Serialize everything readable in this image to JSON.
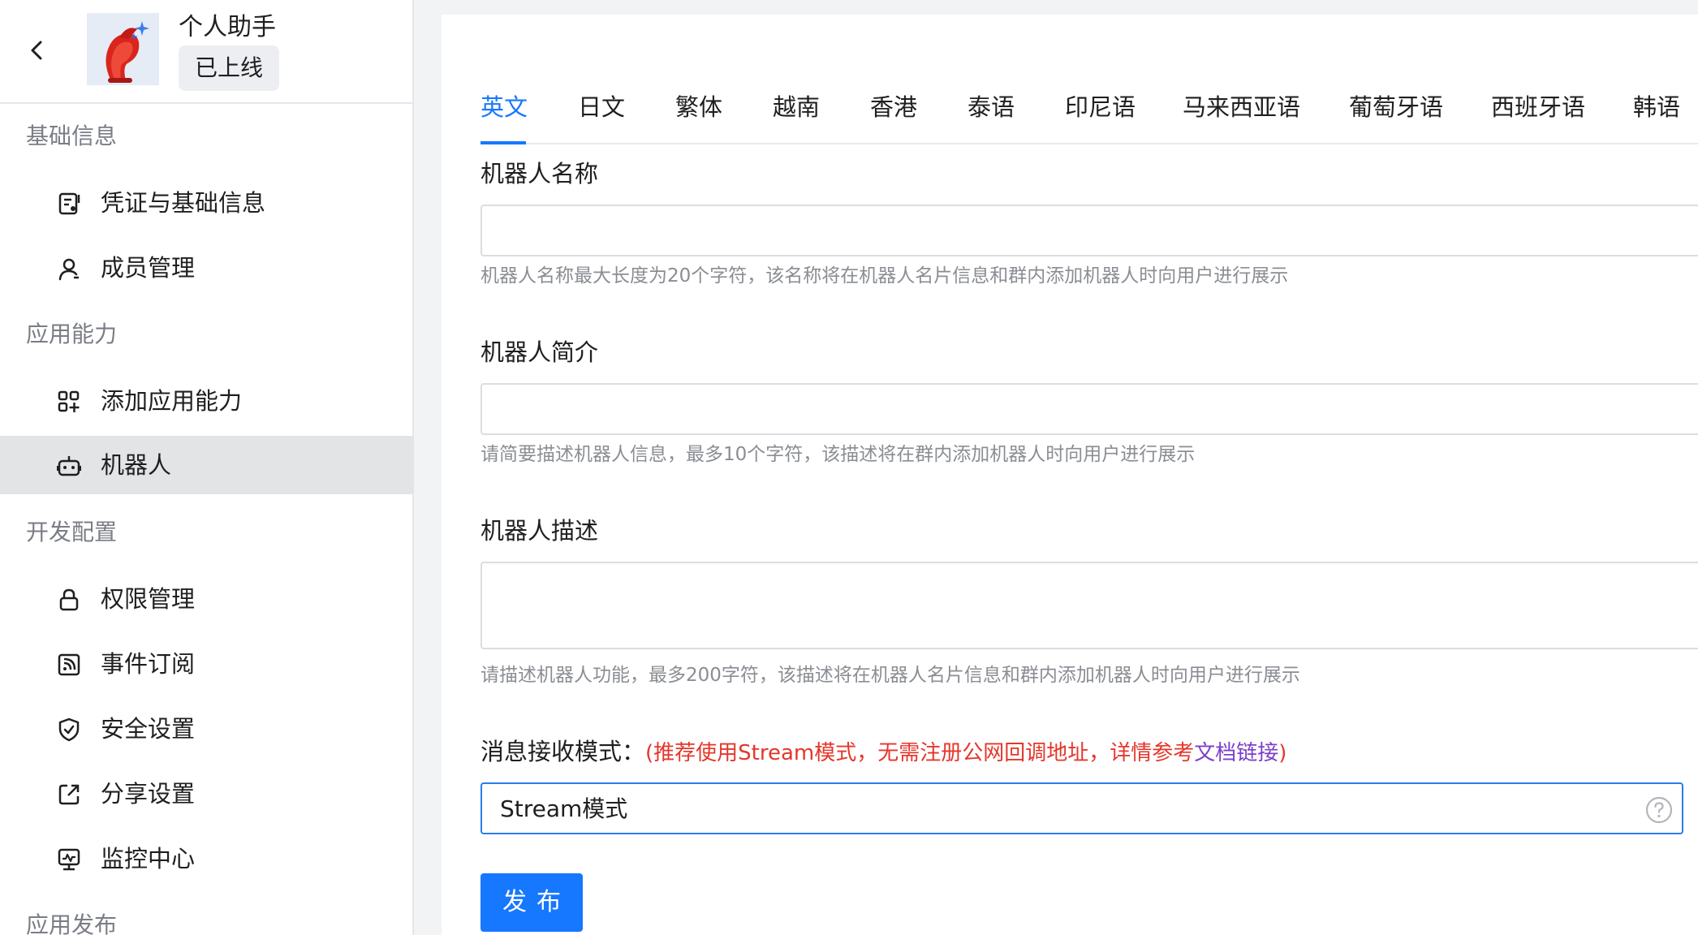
{
  "app": {
    "name": "个人助手",
    "status": "已上线"
  },
  "sidebar": {
    "sections": [
      {
        "title": "基础信息"
      },
      {
        "title": "应用能力"
      },
      {
        "title": "开发配置"
      },
      {
        "title": "应用发布"
      }
    ],
    "items": [
      {
        "label": "凭证与基础信息",
        "icon": "credential-icon"
      },
      {
        "label": "成员管理",
        "icon": "user-icon"
      },
      {
        "label": "添加应用能力",
        "icon": "add-apps-icon"
      },
      {
        "label": "机器人",
        "icon": "robot-icon",
        "active": true
      },
      {
        "label": "权限管理",
        "icon": "lock-icon"
      },
      {
        "label": "事件订阅",
        "icon": "rss-icon"
      },
      {
        "label": "安全设置",
        "icon": "shield-icon"
      },
      {
        "label": "分享设置",
        "icon": "share-icon"
      },
      {
        "label": "监控中心",
        "icon": "monitor-icon"
      }
    ]
  },
  "tabs": [
    {
      "label": "英文",
      "active": true
    },
    {
      "label": "日文"
    },
    {
      "label": "繁体"
    },
    {
      "label": "越南"
    },
    {
      "label": "香港"
    },
    {
      "label": "泰语"
    },
    {
      "label": "印尼语"
    },
    {
      "label": "马来西亚语"
    },
    {
      "label": "葡萄牙语"
    },
    {
      "label": "西班牙语"
    },
    {
      "label": "韩语"
    }
  ],
  "form": {
    "name": {
      "label": "机器人名称",
      "value": "",
      "hint": "机器人名称最大长度为20个字符，该名称将在机器人名片信息和群内添加机器人时向用户进行展示"
    },
    "intro": {
      "label": "机器人简介",
      "value": "",
      "hint": "请简要描述机器人信息，最多10个字符，该描述将在群内添加机器人时向用户进行展示"
    },
    "description": {
      "label": "机器人描述",
      "value": "",
      "hint": "请描述机器人功能，最多200字符，该描述将在机器人名片信息和群内添加机器人时向用户进行展示"
    },
    "mode": {
      "label": "消息接收模式：",
      "note_prefix": "(推荐使用Stream模式，无需注册公网回调地址，详情参考",
      "note_link": "文档链接",
      "note_suffix": ")",
      "selected": "Stream模式"
    },
    "publish_label": "发布"
  },
  "colors": {
    "accent": "#1677ff",
    "note_red": "#e5362b",
    "link_purple": "#7b3fc8"
  }
}
